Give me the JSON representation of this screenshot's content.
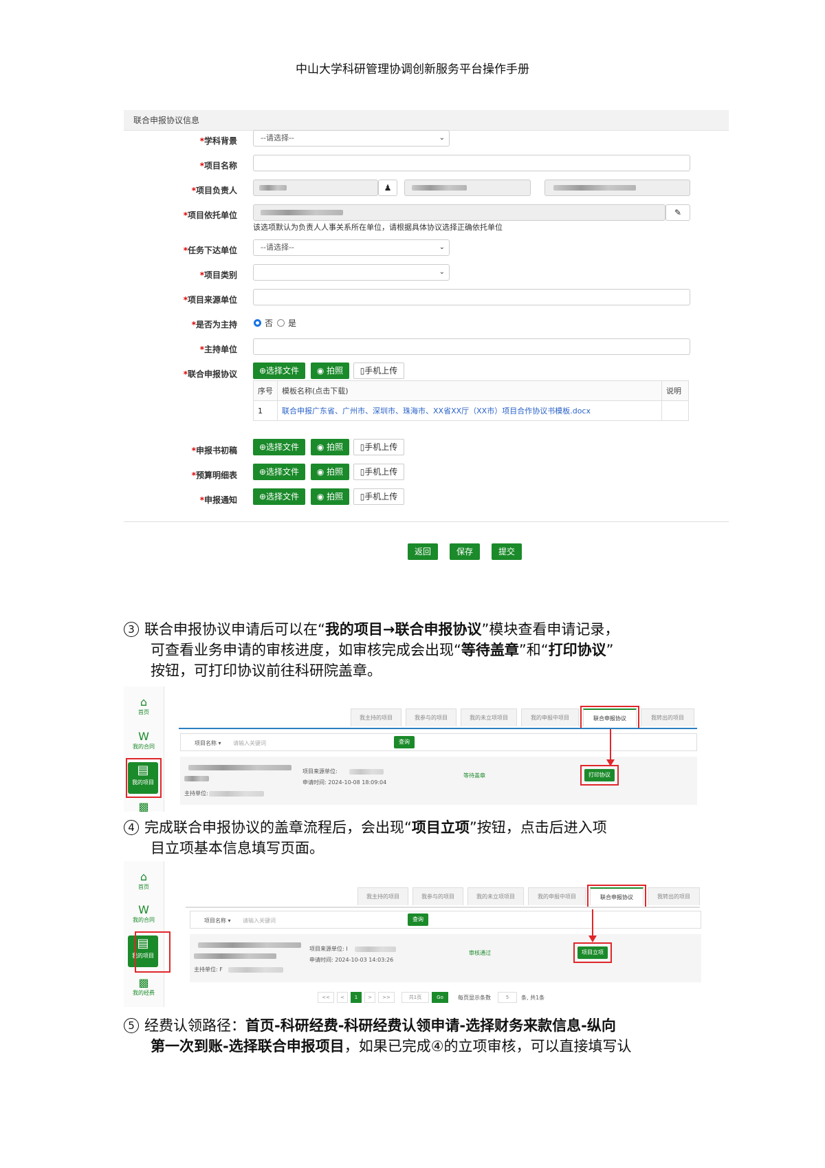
{
  "header": {
    "title": "中山大学科研管理协调创新服务平台操作手册"
  },
  "form": {
    "section_title": "联合申报协议信息",
    "fields": {
      "subject": {
        "label": "学科背景",
        "value": "--请选择--"
      },
      "project_name": {
        "label": "项目名称"
      },
      "leader": {
        "label": "项目负责人"
      },
      "host_unit": {
        "label": "项目依托单位",
        "hint": "该选项默认为负责人人事关系所在单位，请根据具体协议选择正确依托单位"
      },
      "task_unit": {
        "label": "任务下达单位",
        "value": "--请选择--"
      },
      "category": {
        "label": "项目类别",
        "value": ""
      },
      "source_unit": {
        "label": "项目来源单位"
      },
      "is_host": {
        "label": "是否为主持",
        "opt_no": "否",
        "opt_yes": "是",
        "selected": "否"
      },
      "main_unit": {
        "label": "主持单位"
      },
      "agreement": {
        "label": "联合申报协议"
      },
      "draft": {
        "label": "申报书初稿"
      },
      "budget": {
        "label": "预算明细表"
      },
      "notice": {
        "label": "申报通知"
      }
    },
    "upload": {
      "choose": "⊕选择文件",
      "photo": "拍照",
      "mobile": "手机上传"
    },
    "table": {
      "headers": [
        "序号",
        "模板名称(点击下载)",
        "说明"
      ],
      "rows": [
        {
          "no": "1",
          "name": "联合申报广东省、广州市、深圳市、珠海市、XX省XX厅（XX市）项目合作协议书模板.docx",
          "note": ""
        }
      ]
    },
    "actions": {
      "back": "返回",
      "save": "保存",
      "submit": "提交"
    }
  },
  "step3": {
    "num": "3",
    "l1_a": "联合申报协议申请后可以在“",
    "l1_b": "我的项目→联合申报协议",
    "l1_c": "”模块查看申请记录，",
    "l2_a": "可查看业务申请的审核进度，如审核完成会出现“",
    "l2_b": "等待盖章",
    "l2_c": "”和“",
    "l2_d": "打印协议",
    "l2_e": "”",
    "l3": "按钮，可打印协议前往科研院盖章。"
  },
  "step4": {
    "num": "4",
    "l1_a": "完成联合申报协议的盖章流程后，会出现“",
    "l1_b": "项目立项",
    "l1_c": "”按钮，点击后进入项",
    "l2": "目立项基本信息填写页面。"
  },
  "step5": {
    "num": "5",
    "l1_a": "经费认领路径：",
    "l1_b": "首页-科研经费-科研经费认领申请-选择财务来款信息-纵向",
    "l2_a": "第一次到账-选择联合申报项目",
    "l2_b": "，如果已完成④的立项审核，可以直接填写认"
  },
  "shot1": {
    "sidebar": {
      "home": "首页",
      "contract": "我的合同",
      "project": "我的项目"
    },
    "tabs": [
      "我主持的项目",
      "我参与的项目",
      "我的未立项项目",
      "我的申报中项目",
      "联合申报协议",
      "我转出的项目"
    ],
    "filter_label": "项目名称 ▾",
    "search_placeholder": "请输入关键词",
    "search_btn": "查询",
    "source_label": "项目来源单位:",
    "apply_time": "申请时间: 2024-10-08 18:09:04",
    "host_label": "主持单位:",
    "status": "等待盖章",
    "action": "打印协议"
  },
  "shot2": {
    "sidebar": {
      "home": "首页",
      "contract": "我的合同",
      "project": "我的项目",
      "funds": "我的经费"
    },
    "tabs": [
      "我主持的项目",
      "我参与的项目",
      "我的未立项项目",
      "我的申报中项目",
      "联合申报协议",
      "我转出的项目"
    ],
    "filter_label": "项目名称 ▾",
    "search_placeholder": "请输入关键词",
    "search_btn": "查询",
    "source_label": "项目来源单位: I",
    "apply_time": "申请时间: 2024-10-03 14:03:26",
    "host_label": "主持单位: F",
    "status": "审核通过",
    "action": "项目立项",
    "pager": {
      "first": "<<",
      "prev": "<",
      "page": "1",
      "next": ">",
      "last": ">>",
      "total_pages": "共1页",
      "go": "Go",
      "per_page_label": "每页显示条数",
      "per_page": "5",
      "total": "条, 共1条"
    }
  }
}
